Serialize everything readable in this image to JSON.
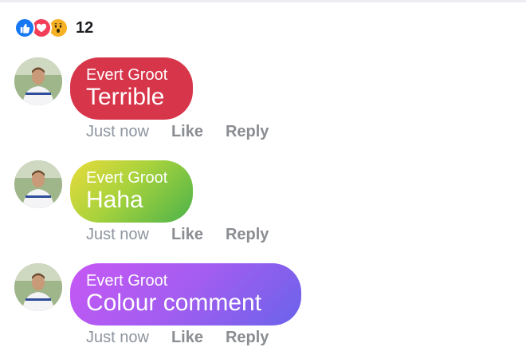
{
  "reactions": {
    "icons": [
      "like-icon",
      "love-icon",
      "wow-icon"
    ],
    "count": "12"
  },
  "comments": [
    {
      "author": "Evert Groot",
      "text": "Terrible",
      "timestamp": "Just now",
      "like_label": "Like",
      "reply_label": "Reply",
      "bubble_color": "#d7354a"
    },
    {
      "author": "Evert Groot",
      "text": "Haha",
      "timestamp": "Just now",
      "like_label": "Like",
      "reply_label": "Reply",
      "bubble_colors": [
        "#e8dc3b",
        "#4bb34a"
      ]
    },
    {
      "author": "Evert Groot",
      "text": "Colour comment",
      "timestamp": "Just now",
      "like_label": "Like",
      "reply_label": "Reply",
      "bubble_colors": [
        "#c758f5",
        "#6a63ea"
      ]
    }
  ],
  "colors": {
    "like_blue": "#1877f2",
    "love_red": "#f33e58",
    "wow_yellow": "#f7b125",
    "secondary_text": "#8d949e"
  }
}
